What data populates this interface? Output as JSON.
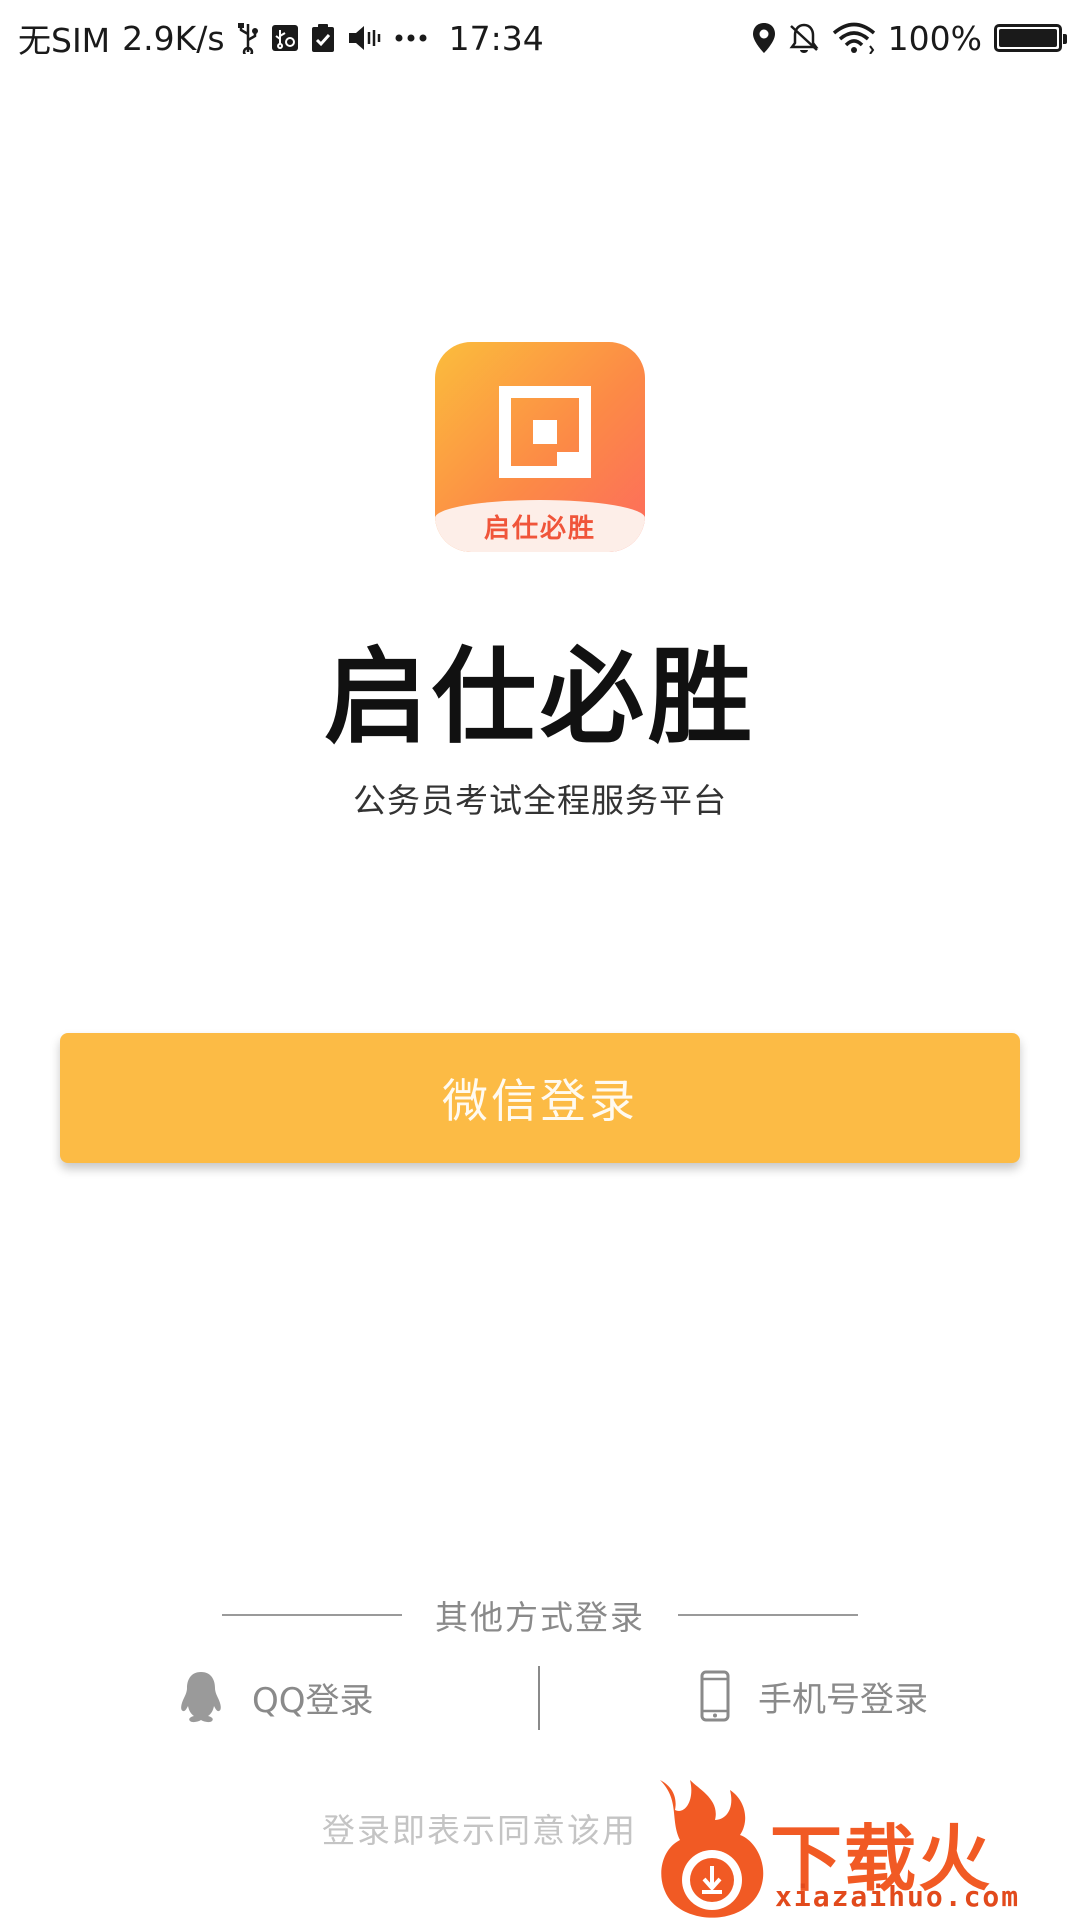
{
  "status_bar": {
    "carrier": "无SIM",
    "net_speed": "2.9K/s",
    "time": "17:34",
    "battery": "100%",
    "icons_left": [
      "usb-icon",
      "usb-debug-icon",
      "clipboard-check-icon",
      "volume-vibrate-icon",
      "more-dots-icon"
    ],
    "icons_right": [
      "location-icon",
      "bell-off-icon",
      "wifi-icon",
      "battery-icon"
    ]
  },
  "logo": {
    "band_text": "启仕必胜",
    "gradient": [
      "#fbbd3c",
      "#fc8a46",
      "#fd6a5e"
    ]
  },
  "app": {
    "title": "启仕必胜",
    "subtitle": "公务员考试全程服务平台"
  },
  "login": {
    "wechat_label": "微信登录",
    "wechat_color": "#fcbb45",
    "other_methods_label": "其他方式登录",
    "qq_label": "QQ登录",
    "phone_label": "手机号登录",
    "agreement_text": "登录即表示同意该用"
  },
  "watermark": {
    "title": "下载火",
    "url": "xiazaihuo.com"
  }
}
